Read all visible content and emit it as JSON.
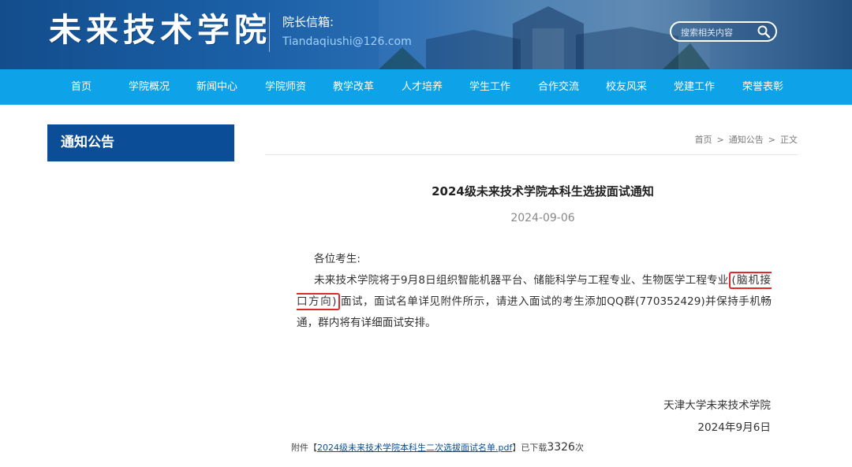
{
  "header": {
    "logo_text": "未来技术学院",
    "mailbox_label": "院长信箱:",
    "mailbox_email": "Tiandaqiushi@126.com",
    "search_placeholder": "搜索相关内容",
    "search_icon": "search-icon"
  },
  "nav": {
    "items": [
      {
        "label": "首页"
      },
      {
        "label": "学院概况"
      },
      {
        "label": "新闻中心"
      },
      {
        "label": "学院师资"
      },
      {
        "label": "教学改革"
      },
      {
        "label": "人才培养"
      },
      {
        "label": "学生工作"
      },
      {
        "label": "合作交流"
      },
      {
        "label": "校友风采"
      },
      {
        "label": "党建工作"
      },
      {
        "label": "荣誉表彰"
      }
    ]
  },
  "sidebar": {
    "title": "通知公告"
  },
  "breadcrumb": {
    "home": "首页",
    "separator": ">",
    "section": "通知公告",
    "current": "正文"
  },
  "article": {
    "title": "2024级未来技术学院本科生选拔面试通知",
    "date": "2024-09-06",
    "greeting": "各位考生:",
    "body_before": "未来技术学院将于9月8日组织智能机器平台、储能科学与工程专业、生物医学工程专业",
    "body_highlight": "(脑机接口方向)",
    "body_after": "面试，面试名单详见附件所示，请进入面试的考生添加QQ群(770352429)并保持手机畅通，群内将有详细面试安排。",
    "signature_org": "天津大学未来技术学院",
    "signature_date": "2024年9月6日"
  },
  "attachment": {
    "prefix": "附件【",
    "link_text": "2024级未来技术学院本科生二次选拔面试名单.pdf",
    "suffix": "】已下载",
    "download_count": "3326",
    "count_unit": "次"
  },
  "colors": {
    "header_bg": "#1a5fa6",
    "nav_bg": "#0ea2e9",
    "sidebar_title_bg": "#0b4e97",
    "email_color": "#9fd0ff",
    "highlight_border": "#e02a2a"
  }
}
